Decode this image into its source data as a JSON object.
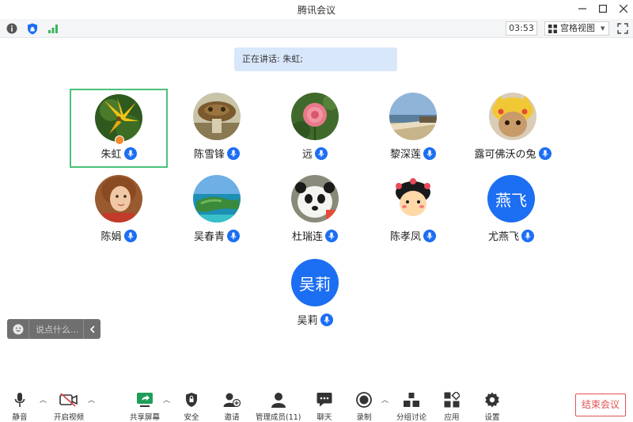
{
  "window": {
    "title": "腾讯会议"
  },
  "infobar": {
    "timer": "03:53",
    "view_label": "宫格视图"
  },
  "speaking": {
    "text": "正在讲话: 朱虹;"
  },
  "participants": [
    {
      "name": "朱虹"
    },
    {
      "name": "陈雪锋"
    },
    {
      "name": "远"
    },
    {
      "name": "黎深莲"
    },
    {
      "name": "露可佛沃の兔"
    },
    {
      "name": "陈娟"
    },
    {
      "name": "吴春青"
    },
    {
      "name": "杜瑞连"
    },
    {
      "name": "陈孝凤"
    },
    {
      "name": "尤燕飞",
      "initials": "燕飞"
    },
    {
      "name": "吴莉",
      "initials": "吴莉"
    }
  ],
  "chat": {
    "placeholder": "说点什么..."
  },
  "toolbar": {
    "mute": "静音",
    "video": "开启视频",
    "share": "共享屏幕",
    "security": "安全",
    "invite": "邀请",
    "members": "管理成员(11)",
    "chat": "聊天",
    "record": "录制",
    "breakout": "分组讨论",
    "apps": "应用",
    "settings": "设置",
    "end": "结束会议"
  },
  "colors": {
    "accent": "#1c6ef2",
    "active_border": "#4bc27b",
    "end": "#e05353"
  }
}
